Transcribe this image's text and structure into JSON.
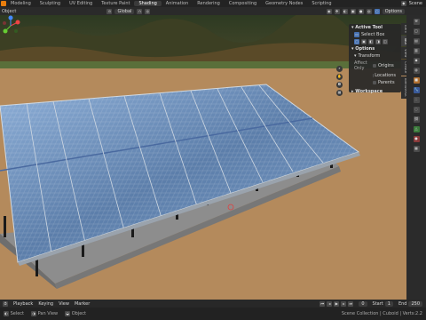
{
  "workspaces": [
    "Modeling",
    "Sculpting",
    "UV Editing",
    "Texture Paint",
    "Shading",
    "Animation",
    "Rendering",
    "Compositing",
    "Geometry Nodes",
    "Scripting"
  ],
  "active_workspace": "Shading",
  "scene": {
    "name": "Scene",
    "options_label": "Options"
  },
  "header": {
    "left_label": "Object",
    "orientation": "Global"
  },
  "npanel": {
    "tabs": [
      "Item",
      "Tool",
      "View",
      "Create",
      "BlenderKit"
    ],
    "active_tool_title": "Active Tool",
    "tool_name": "Select Box",
    "options_title": "Options",
    "transform_title": "Transform",
    "affect_only_label": "Affect Only",
    "origins_label": "Origins",
    "locations_label": "Locations",
    "parents_label": "Parents",
    "workspace_title": "Workspace"
  },
  "timeline": {
    "playback": "Playback",
    "keying": "Keying",
    "view": "View",
    "marker": "Marker",
    "current_frame": "0",
    "start_label": "Start",
    "start": "1",
    "end_label": "End",
    "end": "250"
  },
  "status": {
    "select": "Select",
    "pan": "Pan View",
    "context": "Object",
    "version": "Scene Collection | Cuboid | Verts:2.2"
  },
  "colors": {
    "accent": "#4772b3",
    "ground": "#b48a5c",
    "sky_trees": "#3a3a24",
    "panel_blue": "#6f8fb8",
    "frame_gray": "#8d8d8d"
  },
  "icons": [
    "cursor-icon",
    "move-icon",
    "rotate-icon",
    "scale-icon",
    "camera-icon",
    "hand-icon",
    "zoom-icon",
    "render-icon",
    "modifier-icon",
    "material-icon",
    "object-icon",
    "world-icon",
    "scene-icon",
    "physics-icon",
    "constraint-icon",
    "data-icon"
  ]
}
